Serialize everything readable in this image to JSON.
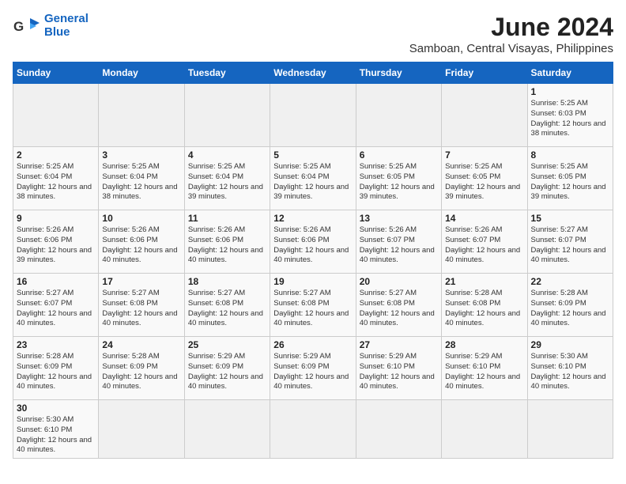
{
  "header": {
    "logo_line1": "General",
    "logo_line2": "Blue",
    "title": "June 2024",
    "subtitle": "Samboan, Central Visayas, Philippines"
  },
  "weekdays": [
    "Sunday",
    "Monday",
    "Tuesday",
    "Wednesday",
    "Thursday",
    "Friday",
    "Saturday"
  ],
  "weeks": [
    [
      {
        "day": "",
        "info": ""
      },
      {
        "day": "",
        "info": ""
      },
      {
        "day": "",
        "info": ""
      },
      {
        "day": "",
        "info": ""
      },
      {
        "day": "",
        "info": ""
      },
      {
        "day": "",
        "info": ""
      },
      {
        "day": "1",
        "info": "Sunrise: 5:25 AM\nSunset: 6:03 PM\nDaylight: 12 hours\nand 38 minutes."
      }
    ],
    [
      {
        "day": "2",
        "info": "Sunrise: 5:25 AM\nSunset: 6:04 PM\nDaylight: 12 hours\nand 38 minutes."
      },
      {
        "day": "3",
        "info": "Sunrise: 5:25 AM\nSunset: 6:04 PM\nDaylight: 12 hours\nand 38 minutes."
      },
      {
        "day": "4",
        "info": "Sunrise: 5:25 AM\nSunset: 6:04 PM\nDaylight: 12 hours\nand 39 minutes."
      },
      {
        "day": "5",
        "info": "Sunrise: 5:25 AM\nSunset: 6:04 PM\nDaylight: 12 hours\nand 39 minutes."
      },
      {
        "day": "6",
        "info": "Sunrise: 5:25 AM\nSunset: 6:05 PM\nDaylight: 12 hours\nand 39 minutes."
      },
      {
        "day": "7",
        "info": "Sunrise: 5:25 AM\nSunset: 6:05 PM\nDaylight: 12 hours\nand 39 minutes."
      },
      {
        "day": "8",
        "info": "Sunrise: 5:25 AM\nSunset: 6:05 PM\nDaylight: 12 hours\nand 39 minutes."
      }
    ],
    [
      {
        "day": "9",
        "info": "Sunrise: 5:26 AM\nSunset: 6:06 PM\nDaylight: 12 hours\nand 39 minutes."
      },
      {
        "day": "10",
        "info": "Sunrise: 5:26 AM\nSunset: 6:06 PM\nDaylight: 12 hours\nand 40 minutes."
      },
      {
        "day": "11",
        "info": "Sunrise: 5:26 AM\nSunset: 6:06 PM\nDaylight: 12 hours\nand 40 minutes."
      },
      {
        "day": "12",
        "info": "Sunrise: 5:26 AM\nSunset: 6:06 PM\nDaylight: 12 hours\nand 40 minutes."
      },
      {
        "day": "13",
        "info": "Sunrise: 5:26 AM\nSunset: 6:07 PM\nDaylight: 12 hours\nand 40 minutes."
      },
      {
        "day": "14",
        "info": "Sunrise: 5:26 AM\nSunset: 6:07 PM\nDaylight: 12 hours\nand 40 minutes."
      },
      {
        "day": "15",
        "info": "Sunrise: 5:27 AM\nSunset: 6:07 PM\nDaylight: 12 hours\nand 40 minutes."
      }
    ],
    [
      {
        "day": "16",
        "info": "Sunrise: 5:27 AM\nSunset: 6:07 PM\nDaylight: 12 hours\nand 40 minutes."
      },
      {
        "day": "17",
        "info": "Sunrise: 5:27 AM\nSunset: 6:08 PM\nDaylight: 12 hours\nand 40 minutes."
      },
      {
        "day": "18",
        "info": "Sunrise: 5:27 AM\nSunset: 6:08 PM\nDaylight: 12 hours\nand 40 minutes."
      },
      {
        "day": "19",
        "info": "Sunrise: 5:27 AM\nSunset: 6:08 PM\nDaylight: 12 hours\nand 40 minutes."
      },
      {
        "day": "20",
        "info": "Sunrise: 5:27 AM\nSunset: 6:08 PM\nDaylight: 12 hours\nand 40 minutes."
      },
      {
        "day": "21",
        "info": "Sunrise: 5:28 AM\nSunset: 6:08 PM\nDaylight: 12 hours\nand 40 minutes."
      },
      {
        "day": "22",
        "info": "Sunrise: 5:28 AM\nSunset: 6:09 PM\nDaylight: 12 hours\nand 40 minutes."
      }
    ],
    [
      {
        "day": "23",
        "info": "Sunrise: 5:28 AM\nSunset: 6:09 PM\nDaylight: 12 hours\nand 40 minutes."
      },
      {
        "day": "24",
        "info": "Sunrise: 5:28 AM\nSunset: 6:09 PM\nDaylight: 12 hours\nand 40 minutes."
      },
      {
        "day": "25",
        "info": "Sunrise: 5:29 AM\nSunset: 6:09 PM\nDaylight: 12 hours\nand 40 minutes."
      },
      {
        "day": "26",
        "info": "Sunrise: 5:29 AM\nSunset: 6:09 PM\nDaylight: 12 hours\nand 40 minutes."
      },
      {
        "day": "27",
        "info": "Sunrise: 5:29 AM\nSunset: 6:10 PM\nDaylight: 12 hours\nand 40 minutes."
      },
      {
        "day": "28",
        "info": "Sunrise: 5:29 AM\nSunset: 6:10 PM\nDaylight: 12 hours\nand 40 minutes."
      },
      {
        "day": "29",
        "info": "Sunrise: 5:30 AM\nSunset: 6:10 PM\nDaylight: 12 hours\nand 40 minutes."
      }
    ],
    [
      {
        "day": "30",
        "info": "Sunrise: 5:30 AM\nSunset: 6:10 PM\nDaylight: 12 hours\nand 40 minutes."
      },
      {
        "day": "",
        "info": ""
      },
      {
        "day": "",
        "info": ""
      },
      {
        "day": "",
        "info": ""
      },
      {
        "day": "",
        "info": ""
      },
      {
        "day": "",
        "info": ""
      },
      {
        "day": "",
        "info": ""
      }
    ]
  ]
}
